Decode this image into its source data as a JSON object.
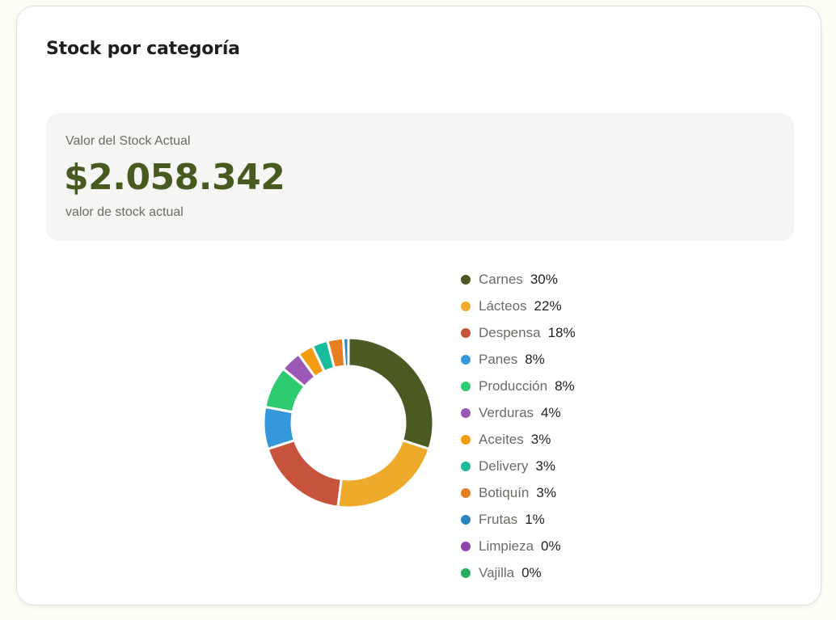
{
  "card": {
    "title": "Stock por categoría"
  },
  "stock": {
    "label": "Valor del Stock Actual",
    "value": "$2.058.342",
    "sublabel": "valor de stock actual"
  },
  "chart_data": {
    "type": "pie",
    "variant": "donut",
    "legend_position": "right",
    "categories": [
      "Carnes",
      "Lácteos",
      "Despensa",
      "Panes",
      "Producción",
      "Verduras",
      "Aceites",
      "Delivery",
      "Botiquín",
      "Frutas",
      "Limpieza",
      "Vajilla"
    ],
    "values": [
      30,
      22,
      18,
      8,
      8,
      4,
      3,
      3,
      3,
      1,
      0,
      0
    ],
    "labels": [
      "30%",
      "22%",
      "18%",
      "8%",
      "8%",
      "4%",
      "3%",
      "3%",
      "3%",
      "1%",
      "0%",
      "0%"
    ],
    "colors": [
      "#4a5a22",
      "#eeaa2b",
      "#c8533c",
      "#3498db",
      "#2ecc71",
      "#9b59b6",
      "#f39c12",
      "#1abc9c",
      "#e67e22",
      "#2e86c1",
      "#8e44ad",
      "#27ae60"
    ]
  }
}
